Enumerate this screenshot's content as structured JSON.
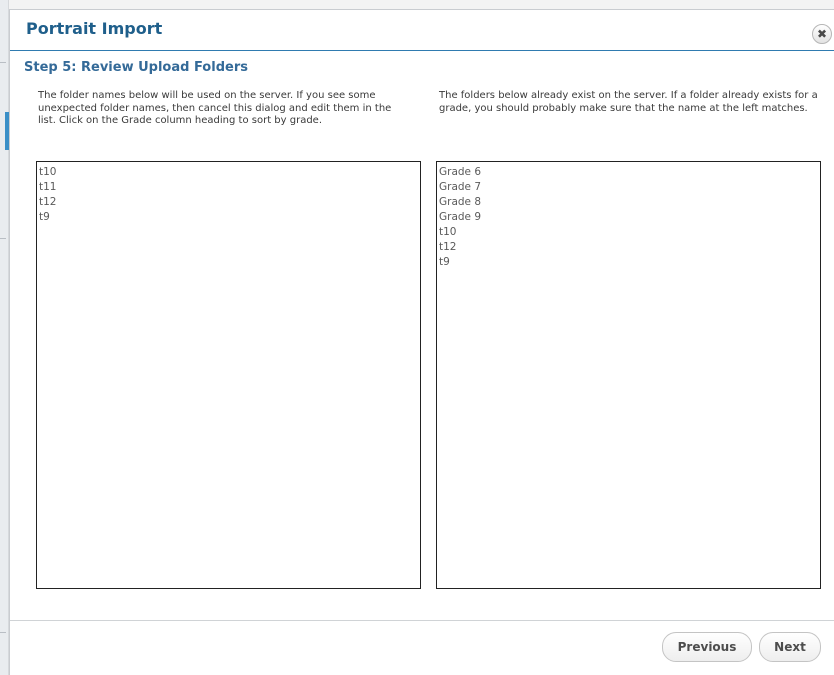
{
  "dialog": {
    "title": "Portrait Import",
    "close_glyph": "✖",
    "close_icon": "close-icon"
  },
  "step": {
    "title": "Step 5: Review Upload Folders"
  },
  "left_panel": {
    "description": "The folder names below will be used on the server. If you see some unexpected folder names, then cancel this dialog and edit them in the list. Click on the Grade column heading to sort by grade.",
    "items": [
      "t10",
      "t11",
      "t12",
      "t9"
    ]
  },
  "right_panel": {
    "description": "The folders below already exist on the server. If a folder already exists for a grade, you should probably make sure that the name at the left matches.",
    "items": [
      "Grade 6",
      "Grade 7",
      "Grade 8",
      "Grade 9",
      "t10",
      "t12",
      "t9"
    ]
  },
  "buttons": {
    "previous_label": "Previous",
    "next_label": "Next"
  },
  "colors": {
    "title": "#1f5f8b",
    "step_title": "#346a98",
    "title_rule": "#2f7bb0"
  }
}
